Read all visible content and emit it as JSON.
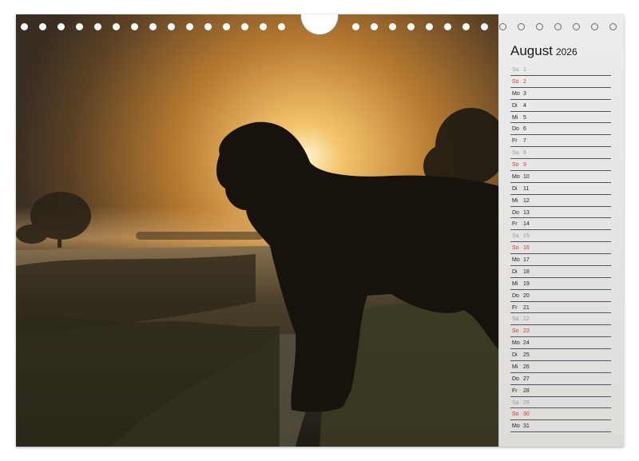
{
  "calendar": {
    "month": "August",
    "year": "2026",
    "days": [
      {
        "dn": "Sa",
        "num": "1",
        "type": "sat"
      },
      {
        "dn": "So",
        "num": "2",
        "type": "sun"
      },
      {
        "dn": "Mo",
        "num": "3",
        "type": "wd"
      },
      {
        "dn": "Di",
        "num": "4",
        "type": "wd"
      },
      {
        "dn": "Mi",
        "num": "5",
        "type": "wd"
      },
      {
        "dn": "Do",
        "num": "6",
        "type": "wd"
      },
      {
        "dn": "Fr",
        "num": "7",
        "type": "wd"
      },
      {
        "dn": "Sa",
        "num": "8",
        "type": "sat"
      },
      {
        "dn": "So",
        "num": "9",
        "type": "sun"
      },
      {
        "dn": "Mo",
        "num": "10",
        "type": "wd"
      },
      {
        "dn": "Di",
        "num": "11",
        "type": "wd"
      },
      {
        "dn": "Mi",
        "num": "12",
        "type": "wd"
      },
      {
        "dn": "Do",
        "num": "13",
        "type": "wd"
      },
      {
        "dn": "Fr",
        "num": "14",
        "type": "wd"
      },
      {
        "dn": "Sa",
        "num": "15",
        "type": "sat"
      },
      {
        "dn": "So",
        "num": "16",
        "type": "sun"
      },
      {
        "dn": "Mo",
        "num": "17",
        "type": "wd"
      },
      {
        "dn": "Di",
        "num": "18",
        "type": "wd"
      },
      {
        "dn": "Mi",
        "num": "19",
        "type": "wd"
      },
      {
        "dn": "Do",
        "num": "20",
        "type": "wd"
      },
      {
        "dn": "Fr",
        "num": "21",
        "type": "wd"
      },
      {
        "dn": "Sa",
        "num": "22",
        "type": "sat"
      },
      {
        "dn": "So",
        "num": "23",
        "type": "sun"
      },
      {
        "dn": "Mo",
        "num": "24",
        "type": "wd"
      },
      {
        "dn": "Di",
        "num": "25",
        "type": "wd"
      },
      {
        "dn": "Mi",
        "num": "26",
        "type": "wd"
      },
      {
        "dn": "Do",
        "num": "27",
        "type": "wd"
      },
      {
        "dn": "Fr",
        "num": "28",
        "type": "wd"
      },
      {
        "dn": "Sa",
        "num": "29",
        "type": "sat"
      },
      {
        "dn": "So",
        "num": "30",
        "type": "sun"
      },
      {
        "dn": "Mo",
        "num": "31",
        "type": "wd"
      }
    ]
  },
  "colors": {
    "sunday": "#d23a2a",
    "saturday": "#9a9a9a",
    "weekday": "#222222",
    "sky_glow": "#f0b85a",
    "panel": "#e6e6e6"
  },
  "photo": {
    "subject": "dog-silhouette-sunrise"
  },
  "binding": {
    "hole_count_left": 15,
    "hole_count_right": 15,
    "icon": "spiral-binding-holes"
  }
}
